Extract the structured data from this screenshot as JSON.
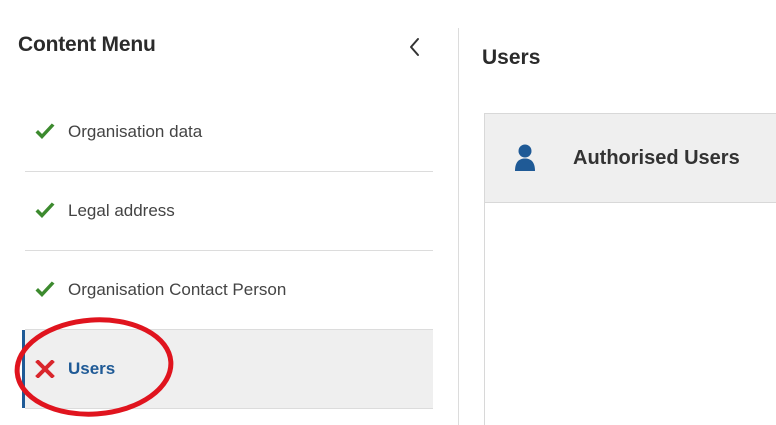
{
  "sidebar": {
    "title": "Content Menu",
    "collapse_icon": "chevron-left-icon",
    "items": [
      {
        "label": "Organisation data",
        "status": "complete",
        "icon": "check-icon",
        "icon_color": "#3c8a2e"
      },
      {
        "label": "Legal address",
        "status": "complete",
        "icon": "check-icon",
        "icon_color": "#3c8a2e"
      },
      {
        "label": "Organisation Contact Person",
        "status": "complete",
        "icon": "check-icon",
        "icon_color": "#3c8a2e"
      },
      {
        "label": "Users",
        "status": "incomplete",
        "icon": "cross-icon",
        "icon_color": "#d9262c",
        "active": true
      }
    ]
  },
  "main": {
    "title": "Users",
    "panel": {
      "title": "Authorised Users",
      "icon": "user-icon"
    }
  },
  "colors": {
    "accent": "#1f5a96",
    "success": "#3c8a2e",
    "error": "#d9262c",
    "highlight": "#e0141e"
  }
}
